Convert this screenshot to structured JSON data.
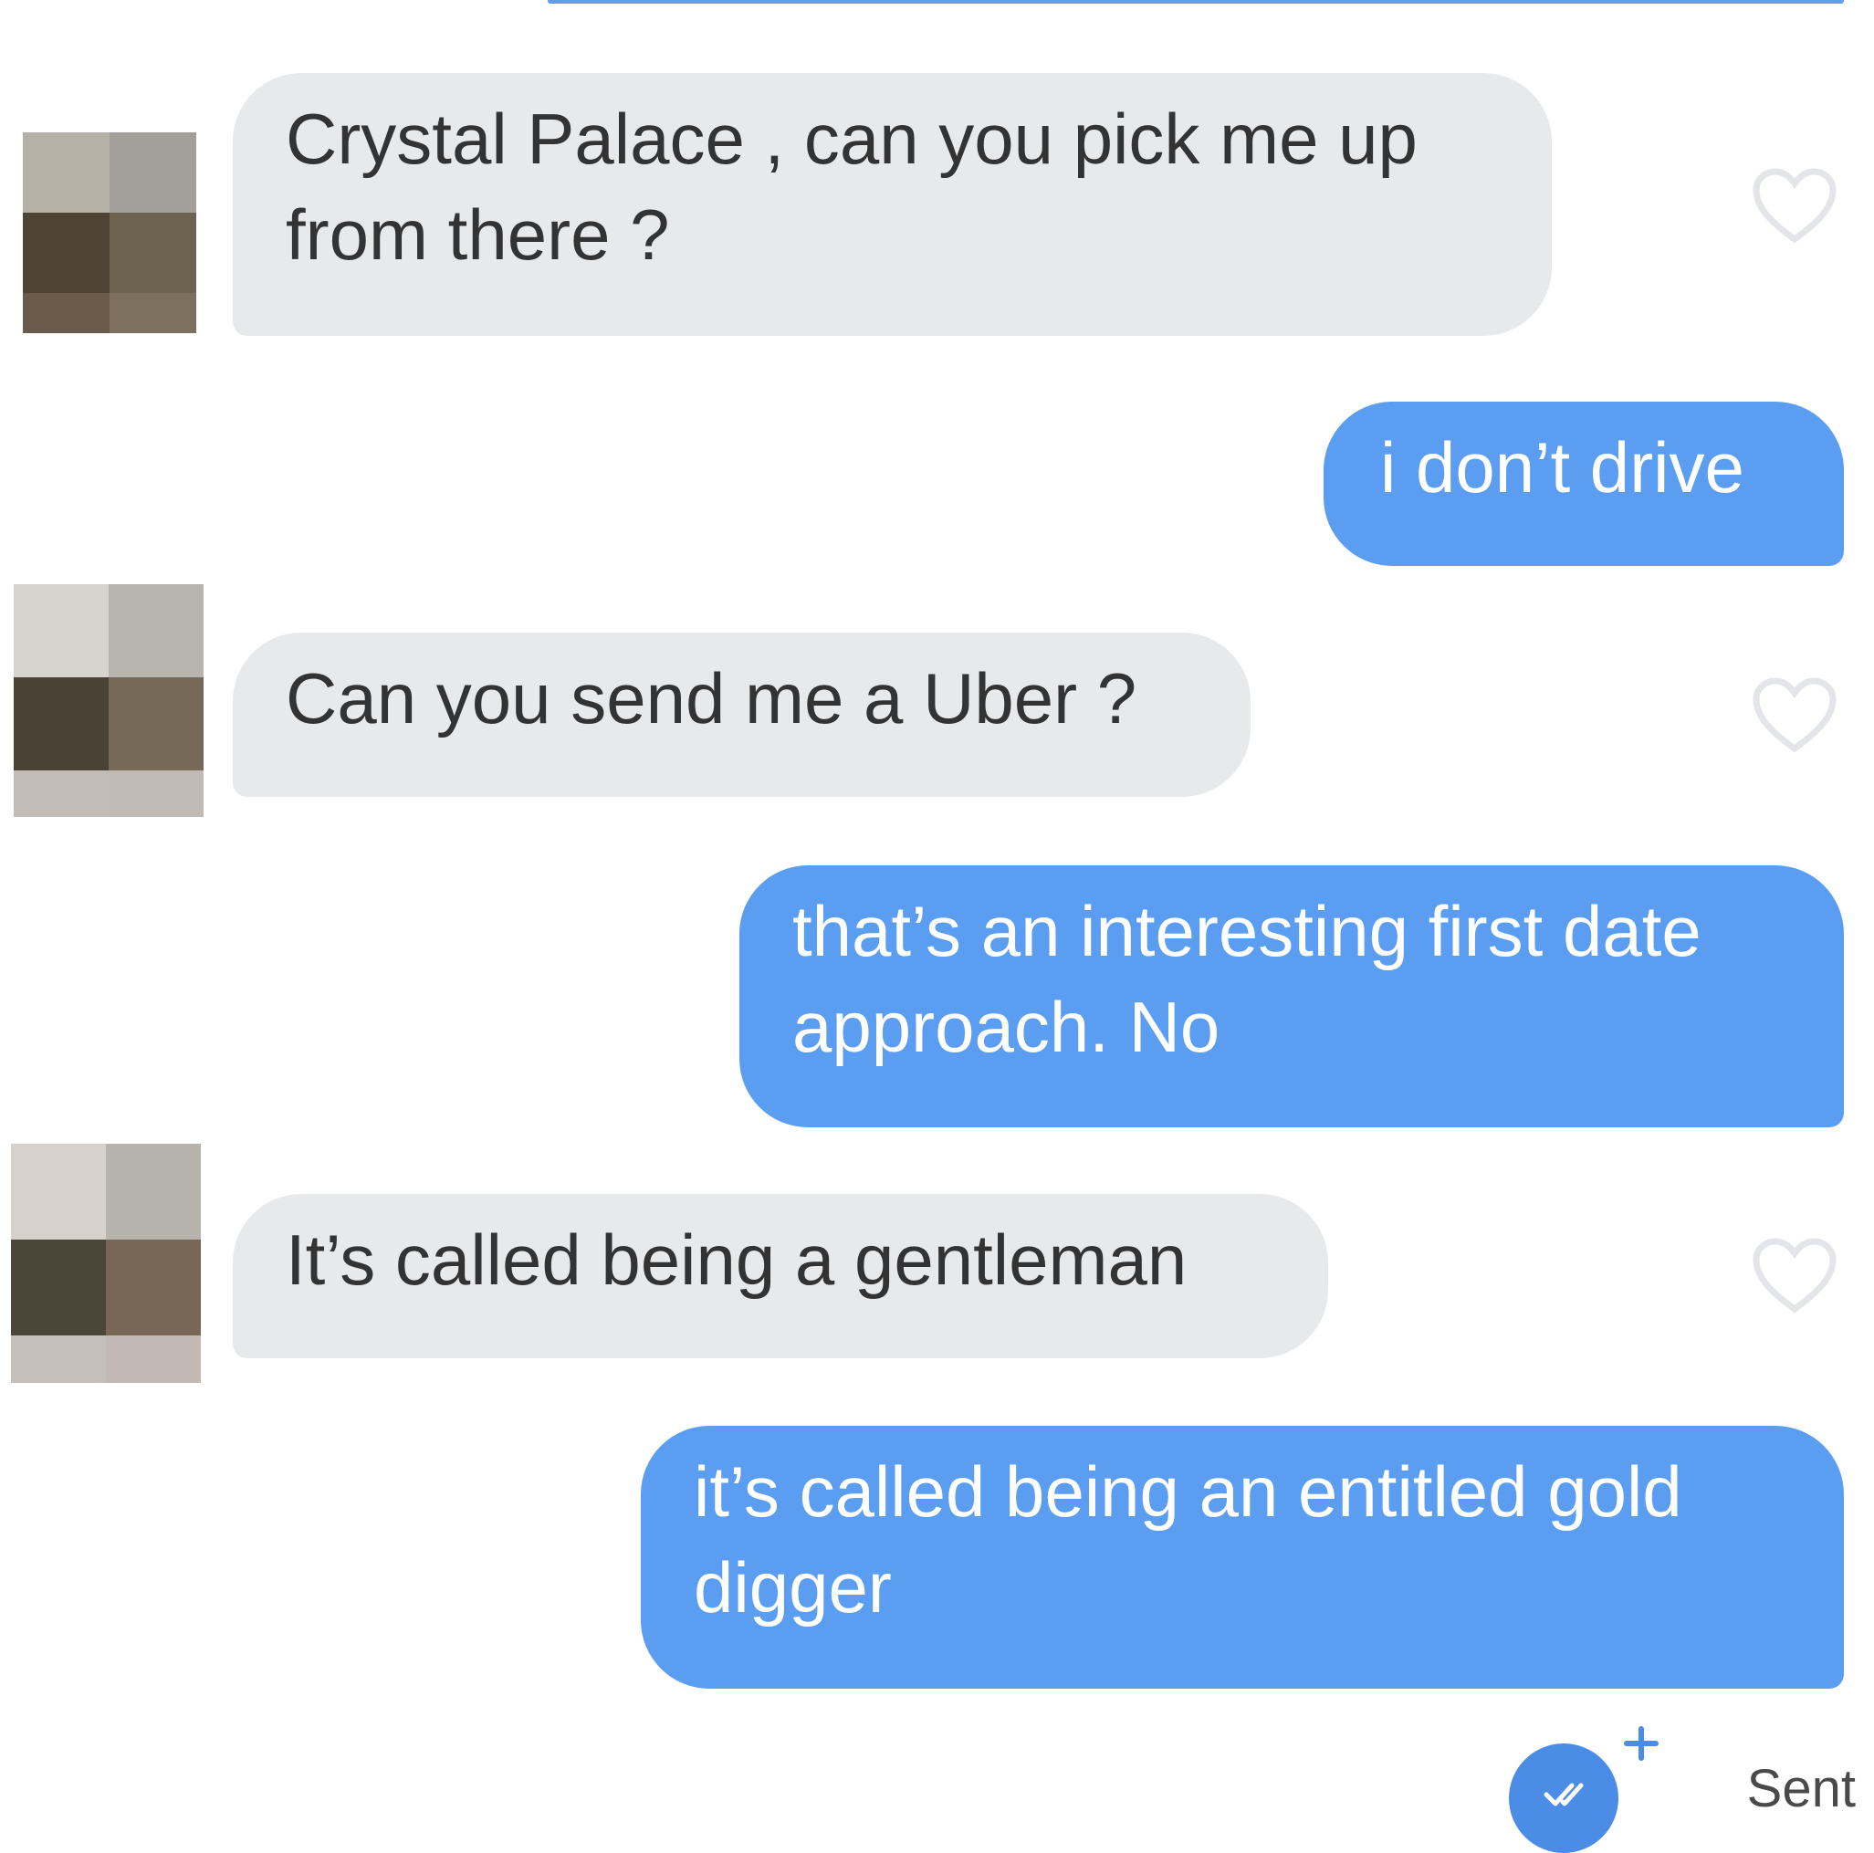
{
  "theme": {
    "received_bg": "#e8e9eb",
    "sent_bg": "#5b9ef1",
    "accent": "#4a8ce6"
  },
  "messages": [
    {
      "id": 0,
      "direction": "received",
      "text": "Crystal Palace , can you pick me up\nfrom there ?",
      "avatar_icon": "pixelated-avatar-icon",
      "like_icon": "heart-outline-icon"
    },
    {
      "id": 1,
      "direction": "sent",
      "text": "i don’t drive"
    },
    {
      "id": 2,
      "direction": "received",
      "text": "Can you send me a Uber ?",
      "avatar_icon": "pixelated-avatar-icon",
      "like_icon": "heart-outline-icon"
    },
    {
      "id": 3,
      "direction": "sent",
      "text": "that’s an interesting first date\napproach. No"
    },
    {
      "id": 4,
      "direction": "received",
      "text": "It’s called being a gentleman",
      "avatar_icon": "pixelated-avatar-icon",
      "like_icon": "heart-outline-icon"
    },
    {
      "id": 5,
      "direction": "sent",
      "text": "it’s called being an entitled gold\ndigger"
    }
  ],
  "status": {
    "label": "Sent",
    "read_icon": "double-check-icon",
    "plus_icon": "plus-icon"
  }
}
